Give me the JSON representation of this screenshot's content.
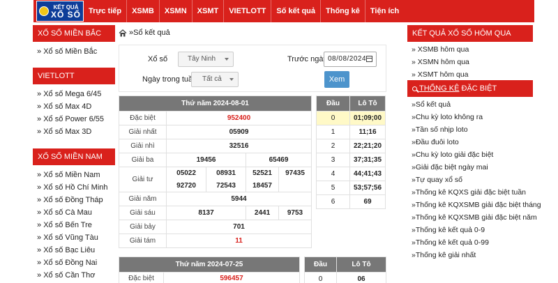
{
  "logo": {
    "line1": "KẾT QUẢ",
    "line2": "XỔ SỐ"
  },
  "nav": [
    "Trực tiếp",
    "XSMB",
    "XSMN",
    "XSMT",
    "VIETLOTT",
    "Số kết quả",
    "Thống kê",
    "Tiện ích"
  ],
  "left_sidebar": {
    "mien_bac": {
      "title": "XỔ SỐ MIỀN BẮC",
      "items": [
        "Xổ số Miền Bắc"
      ]
    },
    "vietlott": {
      "title": "VIETLOTT",
      "items": [
        "Xổ số Mega 6/45",
        "Xổ số Max 4D",
        "Xổ số Power 6/55",
        "Xổ số Max 3D"
      ]
    },
    "mien_nam": {
      "title": "XỔ SỐ MIỀN NAM",
      "items": [
        "Xổ số Miền Nam",
        "Xổ số Hồ Chí Minh",
        "Xổ số Đồng Tháp",
        "Xổ số Cà Mau",
        "Xổ số Bến Tre",
        "Xổ số Vũng Tàu",
        "Xổ số Bạc Liêu",
        "Xổ số Đồng Nai",
        "Xổ số Cần Thơ"
      ]
    }
  },
  "breadcrumb": "Sổ kết quả",
  "form": {
    "xo_so_label": "Xổ số",
    "xo_so_value": "Tây Ninh",
    "truoc_ngay_label": "Trước ngày",
    "truoc_ngay_value": "08/08/2024",
    "ngay_label": "Ngày trong tuần",
    "ngay_value": "Tất cả",
    "submit": "Xem"
  },
  "result1": {
    "header": "Thứ năm 2024-08-01",
    "rows": [
      {
        "label": "Đặc biệt",
        "values": [
          "952400"
        ],
        "red": true
      },
      {
        "label": "Giải nhất",
        "values": [
          "05909"
        ]
      },
      {
        "label": "Giải nhì",
        "values": [
          "32516"
        ]
      },
      {
        "label": "Giải ba",
        "values": [
          "19456",
          "65469"
        ]
      },
      {
        "label": "Giải tư",
        "values": [
          "05022",
          "08931",
          "52521",
          "97435",
          "92720",
          "72543",
          "18457"
        ]
      },
      {
        "label": "Giải năm",
        "values": [
          "5944"
        ]
      },
      {
        "label": "Giải sáu",
        "values": [
          "8137",
          "2441",
          "9753"
        ]
      },
      {
        "label": "Giải bảy",
        "values": [
          "701"
        ]
      },
      {
        "label": "Giải tám",
        "values": [
          "11"
        ],
        "red": true
      }
    ]
  },
  "loto1": {
    "headers": [
      "Đầu",
      "Lô Tô"
    ],
    "rows": [
      [
        "0",
        "01;09;00"
      ],
      [
        "1",
        "11;16"
      ],
      [
        "2",
        "22;21;20"
      ],
      [
        "3",
        "37;31;35"
      ],
      [
        "4",
        "44;41;43"
      ],
      [
        "5",
        "53;57;56"
      ],
      [
        "6",
        "69"
      ]
    ]
  },
  "result2": {
    "header": "Thứ năm 2024-07-25",
    "row_label": "Đặc biệt",
    "row_value": "596457"
  },
  "loto2": {
    "headers": [
      "Đầu",
      "Lô Tô"
    ],
    "row": [
      "0",
      "06"
    ]
  },
  "right_sidebar": {
    "kq_title": "KẾT QUẢ XỔ SỐ HÔM QUA",
    "kq_items": [
      "XSMB hôm qua",
      "XSMN hôm qua",
      "XSMT hôm qua"
    ],
    "tk_title_1": "THỐNG KÊ",
    "tk_title_2": " ĐẶC BIỆT",
    "tk_items": [
      "Sổ kết quả",
      "Chu kỳ loto không ra",
      "Tần số nhịp loto",
      "Đầu đuôi loto",
      "Chu kỳ loto giải đặc biệt",
      "Giải đặc biệt ngày mai",
      "Tự quay xổ số",
      "Thống kê KQXS giải đặc biệt tuần",
      "Thống kê KQXSMB giải đặc biệt tháng",
      "Thống kê KQXSMB giải đặc biệt năm",
      "Thống kê kết quả 0-9",
      "Thống kê kết quả 0-99",
      "Thống kê giải nhất"
    ]
  },
  "colors": {
    "brand_red": "#d9211c",
    "header_gray": "#777777",
    "button_blue": "#4d94cc",
    "highlight": "#fff9c7"
  }
}
